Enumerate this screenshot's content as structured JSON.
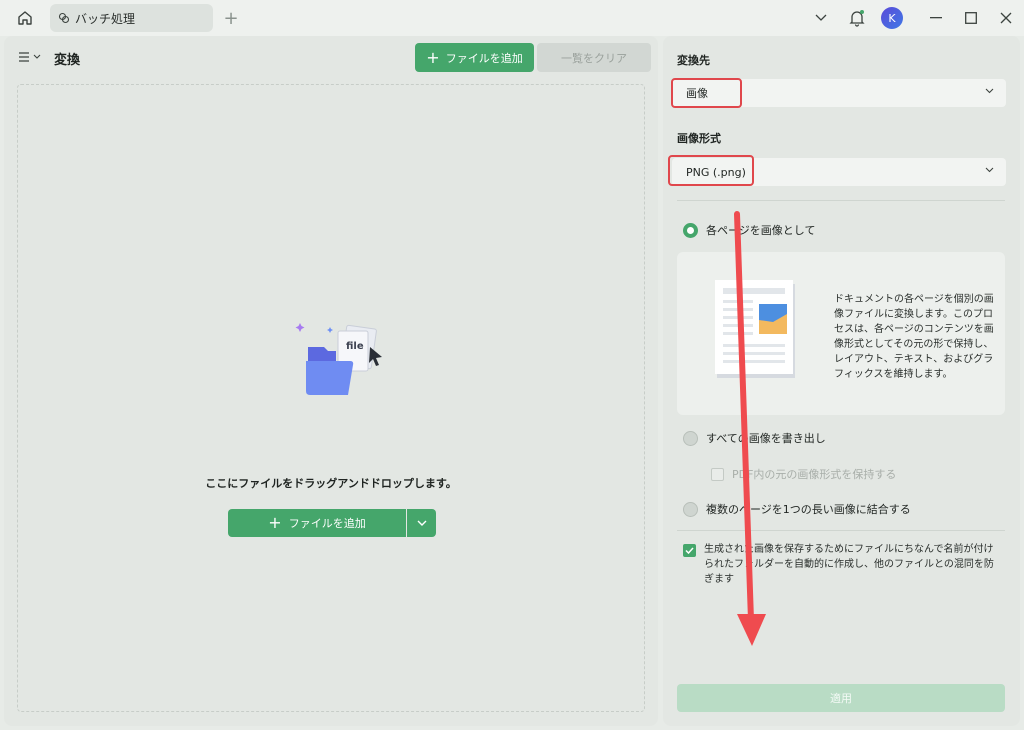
{
  "tab": {
    "title": "バッチ処理"
  },
  "avatar": {
    "initial": "K"
  },
  "left": {
    "title": "変換",
    "add_files": "ファイルを追加",
    "clear_list": "一覧をクリア",
    "drop_text": "ここにファイルをドラッグアンドドロップします。",
    "add_files_main": "ファイルを追加"
  },
  "right": {
    "target_label": "変換先",
    "target_value": "画像",
    "format_label": "画像形式",
    "format_value": "PNG (.png)",
    "option_each_page": "各ページを画像として",
    "info_text": "ドキュメントの各ページを個別の画像ファイルに変換します。このプロセスは、各ページのコンテンツを画像形式としてその元の形で保持し、レイアウト、テキスト、およびグラフィックスを維持します。",
    "option_export_images": "すべての画像を書き出し",
    "keep_format": "PDF内の元の画像形式を保持する",
    "option_combine": "複数のページを1つの長い画像に結合する",
    "folder_option": "生成された画像を保存するためにファイルにちなんで名前が付けられたフォルダーを自動的に作成し、他のファイルとの混同を防ぎます",
    "folder_option_checked": true,
    "apply": "適用"
  },
  "colors": {
    "accent": "#45a66b",
    "highlight": "#e0474c"
  },
  "icons": [
    "home-icon",
    "tab-icon",
    "plus-icon",
    "chevron-down-icon",
    "bell-icon",
    "minimize-icon",
    "maximize-icon",
    "close-icon",
    "menu-icon",
    "check-icon"
  ]
}
